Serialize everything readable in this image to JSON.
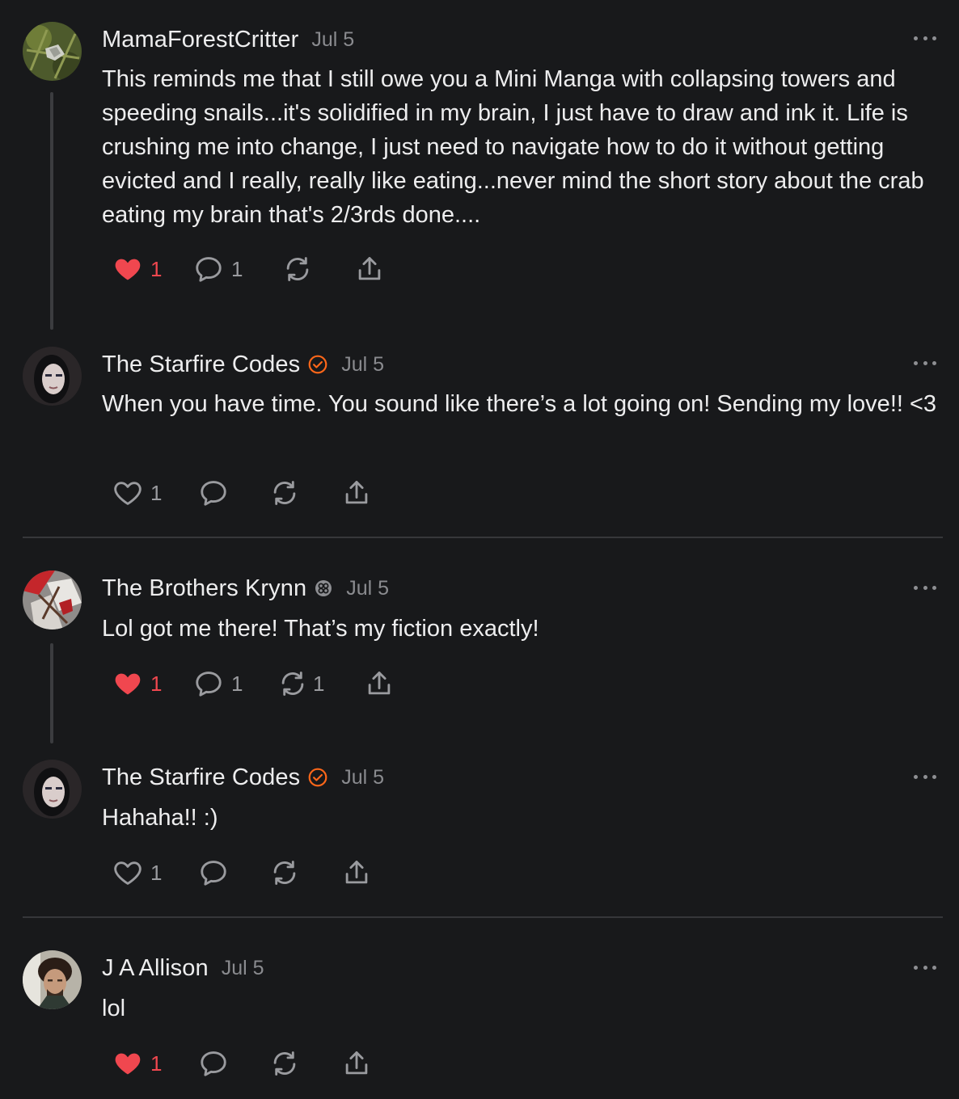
{
  "colors": {
    "background": "#18191b",
    "like_active": "#f0474f",
    "verified": "#ff6719",
    "muted": "#8a8b8f"
  },
  "comments": [
    {
      "author": "MamaForestCritter",
      "date": "Jul 5",
      "badge": null,
      "text": "This reminds me that I still owe you a Mini Manga with collapsing towers and speeding snails...it's solidified in my brain, I just have to draw and ink it. Life is crushing me into change, I just need to navigate how to do it without getting evicted and I really, really like eating...never mind the short story about the crab eating my brain that's 2/3rds done....",
      "likes": "1",
      "liked": true,
      "replies": "1",
      "restacks": "",
      "more_icon": "more-horizontal-icon"
    },
    {
      "author": "The Starfire Codes",
      "date": "Jul 5",
      "badge": "verified-check-icon",
      "text": "When you have time. You sound like there’s a lot going on! Sending my love!! <3",
      "likes": "1",
      "liked": false,
      "replies": "",
      "restacks": ""
    },
    {
      "author": "The Brothers Krynn",
      "date": "Jul 5",
      "badge": "supporter-badge-icon",
      "text": "Lol got me there! That’s my fiction exactly!",
      "likes": "1",
      "liked": true,
      "replies": "1",
      "restacks": "1"
    },
    {
      "author": "The Starfire Codes",
      "date": "Jul 5",
      "badge": "verified-check-icon",
      "text": "Hahaha!! :)",
      "likes": "1",
      "liked": false,
      "replies": "",
      "restacks": ""
    },
    {
      "author": "J A Allison",
      "date": "Jul 5",
      "badge": null,
      "text": "lol",
      "likes": "1",
      "liked": true,
      "replies": "",
      "restacks": ""
    }
  ]
}
